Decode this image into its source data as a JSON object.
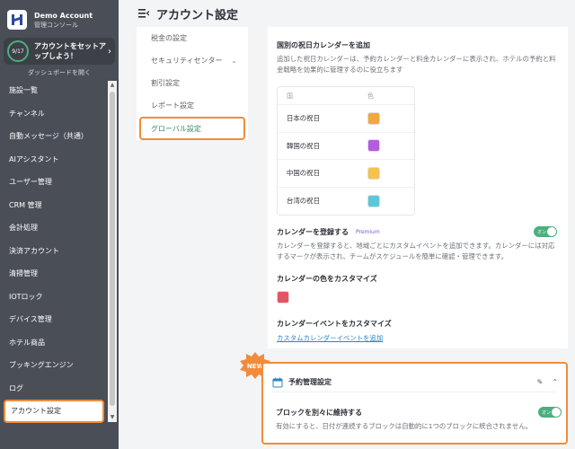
{
  "brand": {
    "name": "Demo Account",
    "subtitle": "管理コンソール"
  },
  "setup": {
    "progress": "9/17",
    "label": "アカウントをセットアップしよう！"
  },
  "dashboard_link": "ダッシュボードを開く",
  "sidebar": {
    "items": [
      {
        "label": "施設一覧"
      },
      {
        "label": "チャンネル"
      },
      {
        "label": "自動メッセージ（共通）"
      },
      {
        "label": "AIアシスタント"
      },
      {
        "label": "ユーザー管理"
      },
      {
        "label": "CRM 管理"
      },
      {
        "label": "会計処理"
      },
      {
        "label": "決済アカウント"
      },
      {
        "label": "清掃管理"
      },
      {
        "label": "IOTロック"
      },
      {
        "label": "デバイス管理"
      },
      {
        "label": "ホテル商品"
      },
      {
        "label": "ブッキングエンジン"
      },
      {
        "label": "ログ"
      },
      {
        "label": "アカウント設定"
      }
    ]
  },
  "header": {
    "title": "アカウント設定"
  },
  "subnav": {
    "items": [
      {
        "label": "税金の設定"
      },
      {
        "label": "セキュリティセンター"
      },
      {
        "label": "割引設定"
      },
      {
        "label": "レポート設定"
      },
      {
        "label": "グローバル設定"
      }
    ]
  },
  "holidays": {
    "title": "国別の祝日カレンダーを追加",
    "description": "追加した祝日カレンダーは、予約カレンダーと料金カレンダーに表示され、ホテルの予約と料金戦略を効果的に管理するのに役立ちます",
    "col_country": "国",
    "col_color": "色",
    "rows": [
      {
        "label": "日本の祝日",
        "color": "#f2a93b"
      },
      {
        "label": "韓国の祝日",
        "color": "#b45ce0"
      },
      {
        "label": "中国の祝日",
        "color": "#f5c24a"
      },
      {
        "label": "台湾の祝日",
        "color": "#5bc8d8"
      }
    ]
  },
  "register_calendar": {
    "title": "カレンダーを登録する",
    "badge": "Premium",
    "toggle_label": "オン",
    "description": "カレンダーを登録すると、地域ごとにカスタムイベントを追加できます。カレンダーには対応するマークが表示され、チームがスケジュールを簡単に確認・管理できます。"
  },
  "customize_color": {
    "title": "カレンダーの色をカスタマイズ",
    "color": "#e25563"
  },
  "customize_event": {
    "title": "カレンダーイベントをカスタマイズ",
    "link": "カスタムカレンダーイベントを追加"
  },
  "booking": {
    "badge": "NEW",
    "title": "予約管理設定",
    "subtitle": "ブロックを別々に維持する",
    "toggle_label": "オン",
    "description": "有効にすると、日付が連続するブロックは自動的に1つのブロックに統合されません。"
  },
  "colors": {
    "accent_orange": "#f08c3c",
    "toggle_green": "#4caf7d",
    "link_blue": "#2a86c8",
    "sidebar_bg": "#4a4f57"
  }
}
